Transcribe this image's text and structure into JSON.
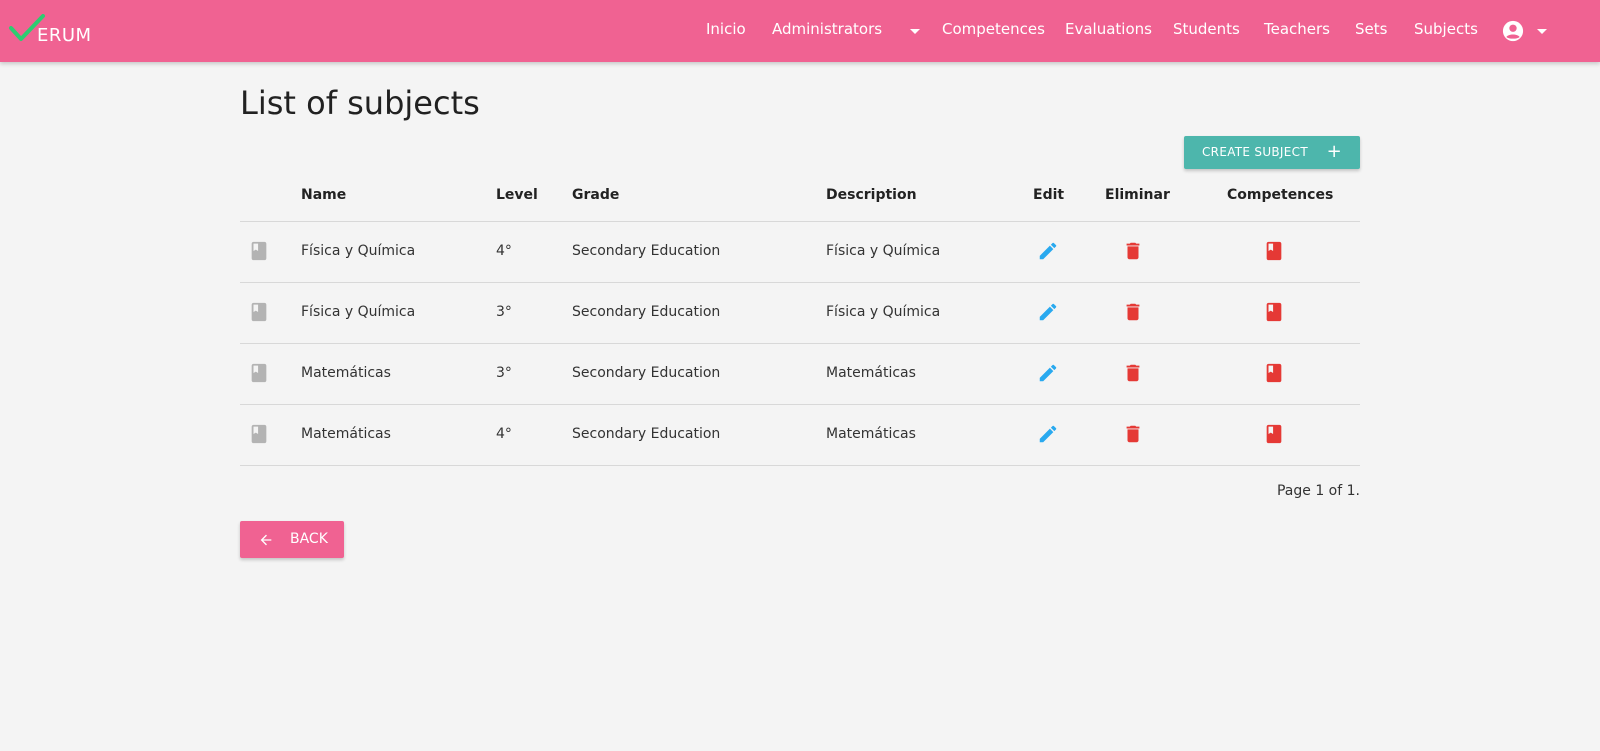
{
  "brand": {
    "text": "ERUM",
    "check_color": "#2ecc71"
  },
  "nav": {
    "items": [
      {
        "label": "Inicio"
      },
      {
        "label": "Administrators"
      },
      {
        "label": "Competences"
      },
      {
        "label": "Evaluations"
      },
      {
        "label": "Students"
      },
      {
        "label": "Teachers"
      },
      {
        "label": "Sets"
      },
      {
        "label": "Subjects"
      }
    ],
    "account_icon": "account-circle-icon"
  },
  "page": {
    "title": "List of subjects",
    "create_button": "CREATE SUBJECT",
    "back_button": "BACK",
    "pagination": "Page 1 of 1."
  },
  "table": {
    "headers": {
      "name": "Name",
      "level": "Level",
      "grade": "Grade",
      "description": "Description",
      "edit": "Edit",
      "delete": "Eliminar",
      "competences": "Competences"
    },
    "rows": [
      {
        "name": "Física y Química",
        "level": "4°",
        "grade": "Secondary Education",
        "description": "Física y Química"
      },
      {
        "name": "Física y Química",
        "level": "3°",
        "grade": "Secondary Education",
        "description": "Física y Química"
      },
      {
        "name": "Matemáticas",
        "level": "3°",
        "grade": "Secondary Education",
        "description": "Matemáticas"
      },
      {
        "name": "Matemáticas",
        "level": "4°",
        "grade": "Secondary Education",
        "description": "Matemáticas"
      }
    ],
    "icons": {
      "row": "book-icon",
      "edit": "pencil-icon",
      "delete": "trash-icon",
      "competences": "bookmark-book-icon"
    }
  },
  "colors": {
    "primary": "#f06292",
    "accent": "#4db6ac",
    "edit": "#29a9ef",
    "delete": "#e53935",
    "row_icon": "#b3b3b3"
  }
}
